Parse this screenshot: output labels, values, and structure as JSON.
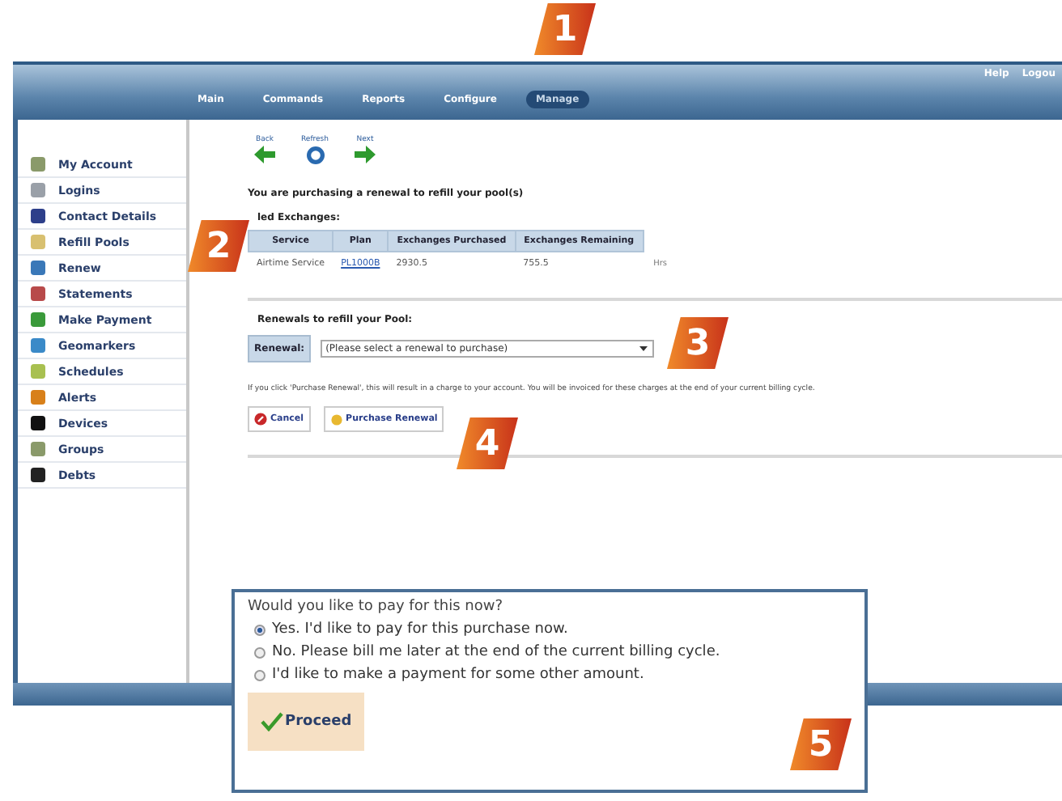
{
  "callouts": [
    "1",
    "2",
    "3",
    "4",
    "5"
  ],
  "header": {
    "nav": [
      {
        "label": "Main",
        "selected": false
      },
      {
        "label": "Commands",
        "selected": false
      },
      {
        "label": "Reports",
        "selected": false
      },
      {
        "label": "Configure",
        "selected": false
      },
      {
        "label": "Manage",
        "selected": true
      }
    ],
    "links": [
      "Help",
      "Logou"
    ]
  },
  "sidebar": {
    "items": [
      "My Account",
      "Logins",
      "Contact Details",
      "Refill Pools",
      "Renew",
      "Statements",
      "Make Payment",
      "Geomarkers",
      "Schedules",
      "Alerts",
      "Devices",
      "Groups",
      "Debts"
    ]
  },
  "toolbar": [
    {
      "label": "Back",
      "kind": "back"
    },
    {
      "label": "Refresh",
      "kind": "refresh"
    },
    {
      "label": "Next",
      "kind": "next"
    }
  ],
  "intro": "You are purchasing a renewal to refill your pool(s)",
  "section_title": "led Exchanges:",
  "table": {
    "columns": [
      "Service",
      "Plan",
      "Exchanges Purchased",
      "Exchanges Remaining"
    ],
    "rows": [
      [
        "Airtime Service",
        "PL1000B",
        "2930.5",
        "755.5",
        "Hrs"
      ]
    ]
  },
  "renewals": {
    "title": "Renewals to refill your Pool:",
    "label": "Renewal:",
    "select": "(Please select a renewal to purchase)"
  },
  "notice": "If you click 'Purchase Renewal', this will result in a charge to your account. You will be invoiced for these charges at the end of your current billing cycle.",
  "buttons": [
    {
      "label": "Cancel",
      "kind": "cancel"
    },
    {
      "label": "Purchase Renewal",
      "kind": "purchase"
    }
  ],
  "dialog": {
    "question": "Would you like to pay for this now?",
    "options": [
      {
        "label": "Yes. I'd like to pay for this purchase now.",
        "selected": true
      },
      {
        "label": "No. Please bill me later at the end of the current billing cycle.",
        "selected": false
      },
      {
        "label": "I'd like to make a payment for some other amount.",
        "selected": false
      }
    ],
    "button": "Proceed"
  }
}
